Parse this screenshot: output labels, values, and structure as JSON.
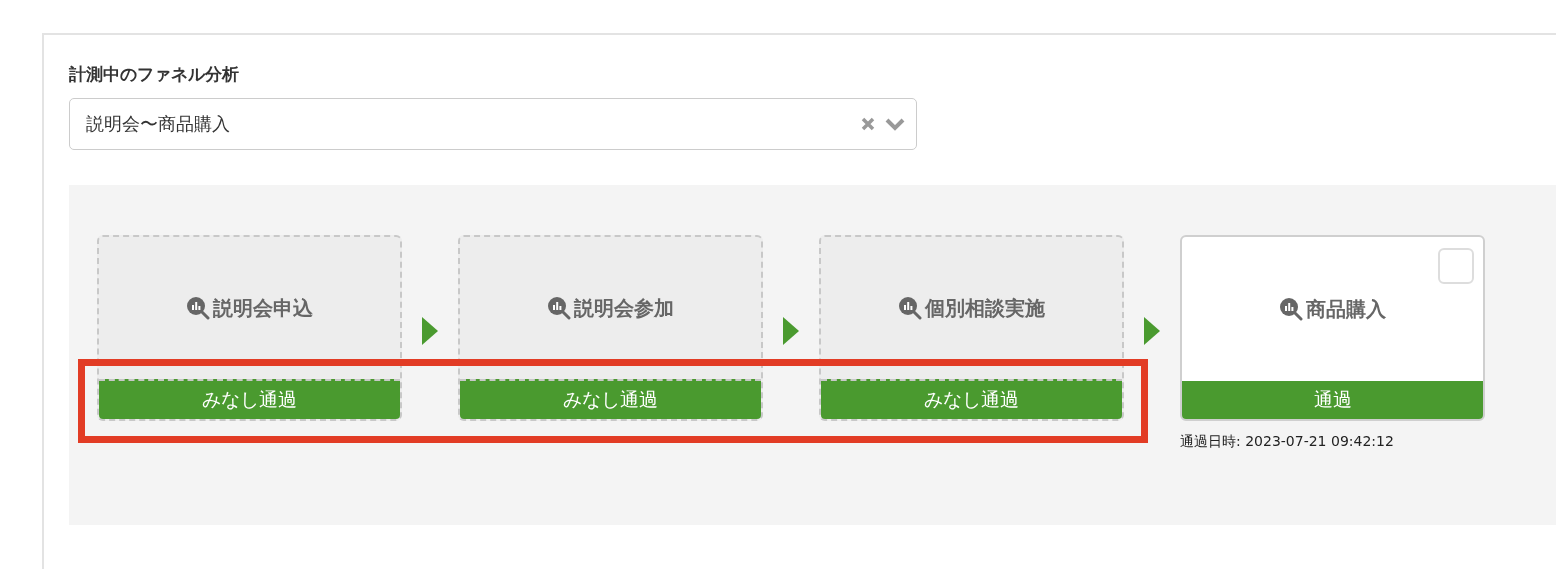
{
  "section_title": "計測中のファネル分析",
  "funnel_select": {
    "value": "説明会〜商品購入"
  },
  "steps": [
    {
      "label": "説明会申込",
      "kind": "assumed",
      "status": "みなし通過"
    },
    {
      "label": "説明会参加",
      "kind": "assumed",
      "status": "みなし通過"
    },
    {
      "label": "個別相談実施",
      "kind": "assumed",
      "status": "みなし通過"
    },
    {
      "label": "商品購入",
      "kind": "passed",
      "status": "通過",
      "checked": false,
      "passed_at": "通過日時: 2023-07-21 09:42:12"
    }
  ],
  "highlight": {
    "shown": true
  }
}
